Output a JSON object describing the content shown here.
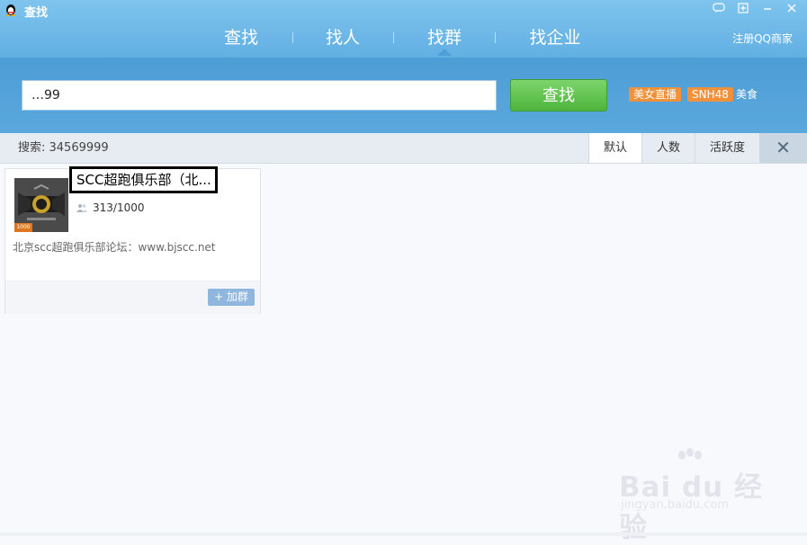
{
  "window": {
    "title": "查找",
    "controls": [
      "chat-icon",
      "add-icon",
      "minimize-icon",
      "close-icon"
    ]
  },
  "nav": {
    "tabs": [
      {
        "label": "查找"
      },
      {
        "label": "找人"
      },
      {
        "label": "找群"
      },
      {
        "label": "找企业"
      }
    ],
    "active_index": 2,
    "register_link": "注册QQ商家"
  },
  "search": {
    "value": "…99",
    "button_label": "查找",
    "tags": [
      "美女直播",
      "SNH48",
      "美食"
    ]
  },
  "results_bar": {
    "count_text": "搜索: 34569999",
    "sort_tabs": [
      "默认",
      "人数",
      "活跃度"
    ],
    "active_sort": 0,
    "close_label": "✕"
  },
  "result": {
    "name": "SCC超跑俱乐部（北...",
    "members": "313/1000",
    "description": "北京scc超跑俱乐部论坛：www.bjscc.net",
    "avatar_badge": "1000",
    "join_label": "+ 加群"
  },
  "watermark": {
    "brand": "Bai du 经验",
    "url": "jingyan.baidu.com"
  },
  "colors": {
    "titlebar": "#6ab6e8",
    "search_band": "#4d9dd6",
    "search_button": "#5fbf4a",
    "tag": "#f1913b",
    "join_button": "#8fb6dc"
  }
}
